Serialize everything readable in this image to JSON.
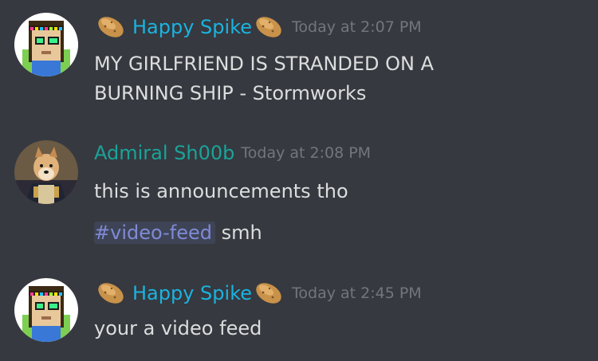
{
  "messages": [
    {
      "username": "Happy Spike",
      "username_color": "#1bb3e0",
      "timestamp": "Today at 2:07 PM",
      "lines": [
        "MY GIRLFRIEND IS STRANDED ON A",
        "BURNING SHIP - Stormworks"
      ],
      "avatar": "pixel-character-avatar",
      "badges": [
        "potato-icon",
        "potato-icon"
      ]
    },
    {
      "username": "Admiral Sh00b",
      "username_color": "#1aa39a",
      "timestamp": "Today at 2:08 PM",
      "lines": [
        "this is announcements tho"
      ],
      "channel_mention": "#video-feed",
      "after_mention": " smh",
      "avatar": "dog-admiral-avatar"
    },
    {
      "username": "Happy Spike",
      "username_color": "#1bb3e0",
      "timestamp": "Today at 2:45 PM",
      "lines": [
        "your a video feed"
      ],
      "avatar": "pixel-character-avatar",
      "badges": [
        "potato-icon",
        "potato-icon"
      ]
    }
  ]
}
